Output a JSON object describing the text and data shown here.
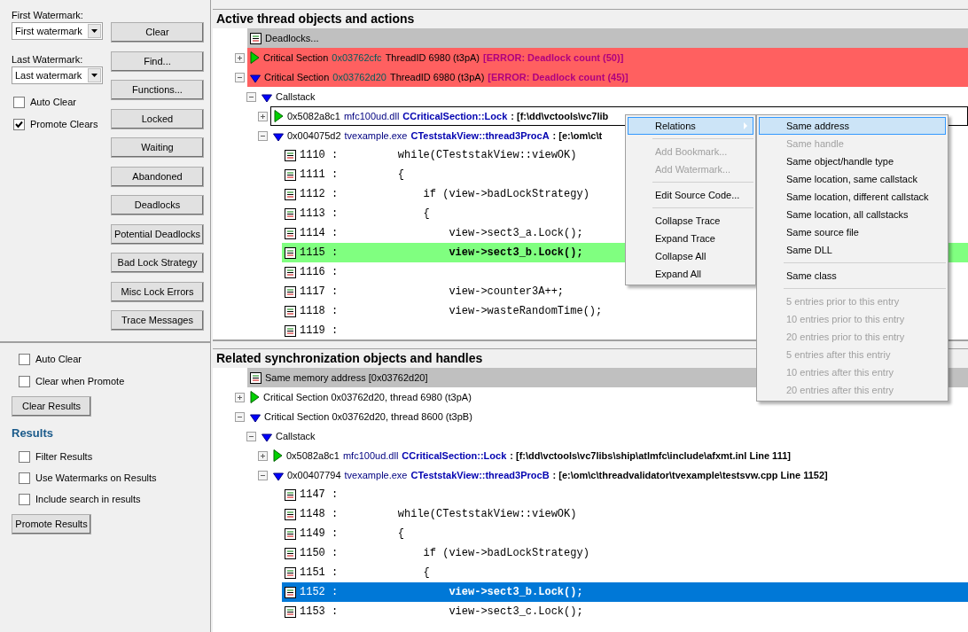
{
  "left_top": {
    "first_watermark": {
      "label": "First Watermark:",
      "value": "First watermark"
    },
    "last_watermark": {
      "label": "Last Watermark:",
      "value": "Last watermark"
    },
    "checkboxes": [
      {
        "label": "Auto Clear",
        "checked": false
      },
      {
        "label": "Promote Clears",
        "checked": true
      }
    ],
    "buttons": [
      "Clear",
      "Find...",
      "Functions...",
      "Locked",
      "Waiting",
      "Abandoned",
      "Deadlocks",
      "Potential Deadlocks",
      "Bad Lock Strategy",
      "Misc Lock Errors",
      "Trace Messages"
    ]
  },
  "left_bottom": {
    "checkboxes": [
      {
        "label": "Auto Clear",
        "checked": false
      },
      {
        "label": "Clear when Promote",
        "checked": false
      }
    ],
    "clear_button": "Clear Results",
    "results_heading": "Results",
    "result_checkboxes": [
      {
        "label": "Filter Results",
        "checked": false
      },
      {
        "label": "Use Watermarks on Results",
        "checked": false
      },
      {
        "label": "Include search in results",
        "checked": false
      }
    ],
    "promote_button": "Promote Results"
  },
  "panes": [
    {
      "title": "Active thread objects and actions",
      "has_focus": false,
      "rows": [
        {
          "kind": "header",
          "text": "Deadlocks...",
          "selected": false
        },
        {
          "kind": "object",
          "expanded": false,
          "error": true,
          "selected": false,
          "parts": [
            {
              "text": "Critical Section",
              "kind": "plain"
            },
            {
              "text": "0x03762cfc",
              "kind": "address"
            },
            {
              "text": "ThreadID 6980 (t3pA)",
              "kind": "plain"
            },
            {
              "text": "[ERROR: Deadlock count (50)]",
              "kind": "error"
            }
          ]
        },
        {
          "kind": "object",
          "expanded": true,
          "error": true,
          "selected": false,
          "parts": [
            {
              "text": "Critical Section",
              "kind": "plain"
            },
            {
              "text": "0x03762d20",
              "kind": "address"
            },
            {
              "text": "ThreadID 6980 (t3pA)",
              "kind": "plain"
            },
            {
              "text": "[ERROR: Deadlock count (45)]",
              "kind": "error"
            }
          ],
          "children": [
            {
              "kind": "group",
              "expanded": true,
              "selected": false,
              "parts": [
                {
                  "text": "Callstack",
                  "kind": "plain"
                }
              ],
              "children": [
                {
                  "kind": "frame",
                  "expanded": false,
                  "selected": true,
                  "parts": [
                    {
                      "text": "0x5082a8c1",
                      "kind": "plain"
                    },
                    {
                      "text": "mfc100ud.dll",
                      "kind": "module"
                    },
                    {
                      "text": "CCriticalSection::Lock",
                      "kind": "function"
                    },
                    {
                      "text": ": [f:\\dd\\vctools\\vc7lib",
                      "kind": "path"
                    }
                  ]
                },
                {
                  "kind": "frame",
                  "expanded": true,
                  "selected": false,
                  "parts": [
                    {
                      "text": "0x004075d2",
                      "kind": "plain"
                    },
                    {
                      "text": "tvexample.exe",
                      "kind": "module"
                    },
                    {
                      "text": "CTeststakView::thread3ProcA",
                      "kind": "function"
                    },
                    {
                      "text": ": [e:\\om\\c\\t",
                      "kind": "path"
                    }
                  ],
                  "children": [
                    {
                      "kind": "line",
                      "number": "1110 :",
                      "code": "    while(CTeststakView::viewOK)",
                      "current": false,
                      "selected": false
                    },
                    {
                      "kind": "line",
                      "number": "1111 :",
                      "code": "    {",
                      "current": false,
                      "selected": false
                    },
                    {
                      "kind": "line",
                      "number": "1112 :",
                      "code": "        if (view->badLockStrategy)",
                      "current": false,
                      "selected": false
                    },
                    {
                      "kind": "line",
                      "number": "1113 :",
                      "code": "        {",
                      "current": false,
                      "selected": false
                    },
                    {
                      "kind": "line",
                      "number": "1114 :",
                      "code": "            view->sect3_a.Lock();",
                      "current": false,
                      "selected": false
                    },
                    {
                      "kind": "line",
                      "number": "1115 :",
                      "code": "            view->sect3_b.Lock();",
                      "current": true,
                      "selected": false
                    },
                    {
                      "kind": "line",
                      "number": "1116 :",
                      "current": false,
                      "selected": false
                    },
                    {
                      "kind": "line",
                      "number": "1117 :",
                      "code": "            view->counter3A++;",
                      "current": false,
                      "selected": false
                    },
                    {
                      "kind": "line",
                      "number": "1118 :",
                      "code": "            view->wasteRandomTime();",
                      "current": false,
                      "selected": false
                    },
                    {
                      "kind": "line",
                      "number": "1119 :",
                      "current": false,
                      "selected": false
                    }
                  ]
                }
              ]
            }
          ]
        }
      ]
    },
    {
      "title": "Related synchronization objects and handles",
      "has_focus": true,
      "rows": [
        {
          "kind": "header",
          "text": "Same memory address [0x03762d20]",
          "selected": false
        },
        {
          "kind": "object",
          "expanded": false,
          "error": false,
          "selected": false,
          "parts": [
            {
              "text": "Critical Section 0x03762d20, thread 6980 (t3pA)",
              "kind": "plain"
            }
          ]
        },
        {
          "kind": "object",
          "expanded": true,
          "error": false,
          "selected": false,
          "parts": [
            {
              "text": "Critical Section 0x03762d20, thread 8600 (t3pB)",
              "kind": "plain"
            }
          ],
          "children": [
            {
              "kind": "group",
              "expanded": true,
              "selected": false,
              "parts": [
                {
                  "text": "Callstack",
                  "kind": "plain"
                }
              ],
              "children": [
                {
                  "kind": "frame",
                  "expanded": false,
                  "selected": false,
                  "parts": [
                    {
                      "text": "0x5082a8c1",
                      "kind": "plain"
                    },
                    {
                      "text": "mfc100ud.dll",
                      "kind": "module"
                    },
                    {
                      "text": "CCriticalSection::Lock",
                      "kind": "function"
                    },
                    {
                      "text": ": [f:\\dd\\vctools\\vc7libs\\ship\\atlmfc\\include\\afxmt.inl Line 111]",
                      "kind": "path"
                    }
                  ]
                },
                {
                  "kind": "frame",
                  "expanded": true,
                  "selected": false,
                  "parts": [
                    {
                      "text": "0x00407794",
                      "kind": "plain"
                    },
                    {
                      "text": "tvexample.exe",
                      "kind": "module"
                    },
                    {
                      "text": "CTeststakView::thread3ProcB",
                      "kind": "function"
                    },
                    {
                      "text": ": [e:\\om\\c\\threadvalidator\\tvexample\\testsvw.cpp Line 1152]",
                      "kind": "path"
                    }
                  ],
                  "children": [
                    {
                      "kind": "line",
                      "number": "1147 :",
                      "current": false,
                      "selected": false
                    },
                    {
                      "kind": "line",
                      "number": "1148 :",
                      "code": "    while(CTeststakView::viewOK)",
                      "current": false,
                      "selected": false
                    },
                    {
                      "kind": "line",
                      "number": "1149 :",
                      "code": "    {",
                      "current": false,
                      "selected": false
                    },
                    {
                      "kind": "line",
                      "number": "1150 :",
                      "code": "        if (view->badLockStrategy)",
                      "current": false,
                      "selected": false
                    },
                    {
                      "kind": "line",
                      "number": "1151 :",
                      "code": "        {",
                      "current": false,
                      "selected": false
                    },
                    {
                      "kind": "line",
                      "number": "1152 :",
                      "code": "            view->sect3_b.Lock();",
                      "current": false,
                      "selected": true
                    },
                    {
                      "kind": "line",
                      "number": "1153 :",
                      "code": "            view->sect3_c.Lock();",
                      "current": false,
                      "selected": false
                    }
                  ]
                }
              ]
            }
          ]
        }
      ]
    }
  ],
  "context_menu": {
    "items": [
      {
        "kind": "item",
        "label": "Relations",
        "submenu": true,
        "selected": true,
        "disabled": false
      },
      {
        "kind": "separator"
      },
      {
        "kind": "item",
        "label": "Add Bookmark...",
        "selected": false,
        "disabled": true
      },
      {
        "kind": "item",
        "label": "Add Watermark...",
        "selected": false,
        "disabled": true
      },
      {
        "kind": "separator"
      },
      {
        "kind": "item",
        "label": "Edit Source Code...",
        "selected": false,
        "disabled": false
      },
      {
        "kind": "separator"
      },
      {
        "kind": "item",
        "label": "Collapse Trace",
        "selected": false,
        "disabled": false
      },
      {
        "kind": "item",
        "label": "Expand Trace",
        "selected": false,
        "disabled": false
      },
      {
        "kind": "item",
        "label": "Collapse All",
        "selected": false,
        "disabled": false
      },
      {
        "kind": "item",
        "label": "Expand All",
        "selected": false,
        "disabled": false
      }
    ],
    "submenu": {
      "items": [
        {
          "kind": "item",
          "label": "Same address",
          "selected": true,
          "disabled": false
        },
        {
          "kind": "item",
          "label": "Same handle",
          "selected": false,
          "disabled": true
        },
        {
          "kind": "item",
          "label": "Same object/handle type",
          "selected": false,
          "disabled": false
        },
        {
          "kind": "item",
          "label": "Same location, same callstack",
          "selected": false,
          "disabled": false
        },
        {
          "kind": "item",
          "label": "Same location, different callstack",
          "selected": false,
          "disabled": false
        },
        {
          "kind": "item",
          "label": "Same location, all callstacks",
          "selected": false,
          "disabled": false
        },
        {
          "kind": "item",
          "label": "Same source file",
          "selected": false,
          "disabled": false
        },
        {
          "kind": "item",
          "label": "Same DLL",
          "selected": false,
          "disabled": false
        },
        {
          "kind": "separator"
        },
        {
          "kind": "item",
          "label": "Same class",
          "selected": false,
          "disabled": false
        },
        {
          "kind": "separator"
        },
        {
          "kind": "item",
          "label": "5 entries prior to this entry",
          "selected": false,
          "disabled": true
        },
        {
          "kind": "item",
          "label": "10 entries prior to this entry",
          "selected": false,
          "disabled": true
        },
        {
          "kind": "item",
          "label": "20 entries prior to this entry",
          "selected": false,
          "disabled": true
        },
        {
          "kind": "item",
          "label": "5 entries after this entriy",
          "selected": false,
          "disabled": true
        },
        {
          "kind": "item",
          "label": "10 entries after this entry",
          "selected": false,
          "disabled": true
        },
        {
          "kind": "item",
          "label": "20 entries after this entry",
          "selected": false,
          "disabled": true
        }
      ]
    }
  }
}
